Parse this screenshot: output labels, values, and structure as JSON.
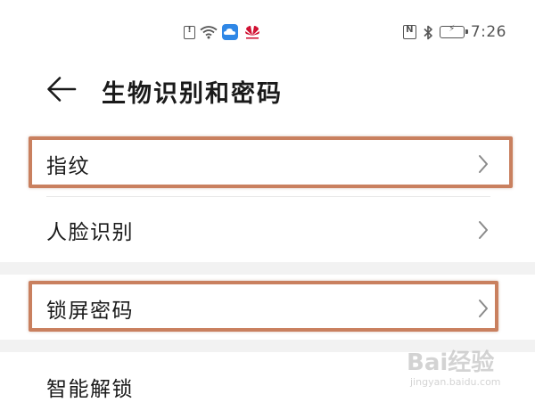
{
  "status_bar": {
    "time": "7:26",
    "icons": [
      "alert-icon",
      "wifi-icon",
      "cloud-icon",
      "huawei-icon",
      "nfc-icon",
      "bluetooth-icon",
      "battery-icon"
    ]
  },
  "header": {
    "title": "生物识别和密码",
    "back_icon": "back-arrow-icon"
  },
  "list": {
    "items": [
      {
        "label": "指纹",
        "icon": "chevron-right-icon",
        "highlighted": true
      },
      {
        "label": "人脸识别",
        "icon": "chevron-right-icon",
        "highlighted": false
      },
      {
        "label": "锁屏密码",
        "icon": "chevron-right-icon",
        "highlighted": true
      },
      {
        "label": "智能解锁",
        "icon": "chevron-right-icon",
        "highlighted": false
      }
    ]
  },
  "watermark": {
    "logo": "Bai经验",
    "url": "jingyan.baidu.com"
  },
  "colors": {
    "highlight_border": "#c9805f",
    "text": "#1a1a1a",
    "section_gap": "#f2f2f2",
    "cloud_icon": "#2f87e6",
    "huawei_logo": "#cf0a2c"
  }
}
